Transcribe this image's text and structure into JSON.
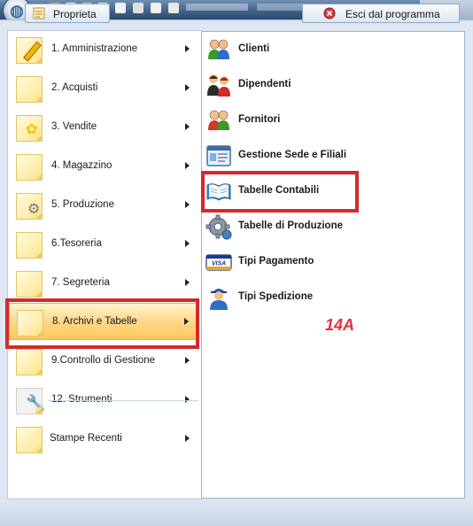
{
  "left_menu": [
    {
      "label": "1. Amministrazione",
      "icon": "pencil-icon"
    },
    {
      "label": "2. Acquisti",
      "icon": "note-icon"
    },
    {
      "label": "3. Vendite",
      "icon": "flower-note-icon"
    },
    {
      "label": "4. Magazzino",
      "icon": "note-icon"
    },
    {
      "label": "5. Produzione",
      "icon": "gear-note-icon"
    },
    {
      "label": "6.Tesoreria",
      "icon": "note-icon"
    },
    {
      "label": "7. Segreteria",
      "icon": "note-icon"
    },
    {
      "label": "8. Archivi e Tabelle",
      "icon": "note-icon",
      "selected": true
    },
    {
      "label": "9.Controllo di Gestione",
      "icon": "note-icon"
    },
    {
      "label": "12. Strumenti",
      "icon": "wrench-icon"
    },
    {
      "label": "Stampe Recenti",
      "icon": "note-icon"
    }
  ],
  "submenu": [
    {
      "label": "Clienti",
      "icon": "clients-icon"
    },
    {
      "label": "Dipendenti",
      "icon": "employees-icon"
    },
    {
      "label": "Fornitori",
      "icon": "suppliers-icon"
    },
    {
      "label": "Gestione Sede e Filiali",
      "icon": "card-icon"
    },
    {
      "label": "Tabelle Contabili",
      "icon": "book-icon"
    },
    {
      "label": "Tabelle di Produzione",
      "icon": "gear-icon"
    },
    {
      "label": "Tipi Pagamento",
      "icon": "visa-card-icon"
    },
    {
      "label": "Tipi Spedizione",
      "icon": "delivery-person-icon"
    }
  ],
  "annotation": "14A",
  "visa_text": "VISA",
  "footer": {
    "properties_label": "Proprieta",
    "exit_label": "Esci dal programma"
  },
  "colors": {
    "highlight_border": "#d42a2a",
    "annotation": "#e0333b",
    "selected_item": "#ffd88b"
  }
}
